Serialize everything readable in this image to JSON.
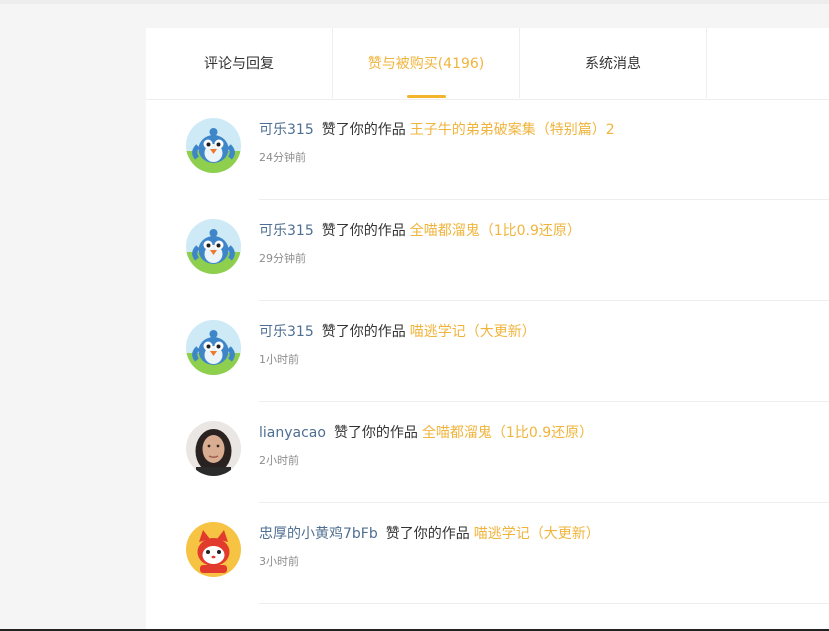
{
  "tabs": [
    {
      "label": "评论与回复",
      "active": false
    },
    {
      "label": "赞与被购买(4196)",
      "active": true
    },
    {
      "label": "系统消息",
      "active": false
    },
    {
      "label": "",
      "active": false
    }
  ],
  "notifications": [
    {
      "user": "可乐315",
      "action": "赞了你的作品",
      "work": "王子牛的弟弟破案集（特别篇）2",
      "time": "24分钟前",
      "avatar": "bird-avatar"
    },
    {
      "user": "可乐315",
      "action": "赞了你的作品",
      "work": "全喵都溜鬼（1比0.9还原）",
      "time": "29分钟前",
      "avatar": "bird-avatar"
    },
    {
      "user": "可乐315",
      "action": "赞了你的作品",
      "work": "喵逃学记（大更新）",
      "time": "1小时前",
      "avatar": "bird-avatar"
    },
    {
      "user": "lianyacao",
      "action": "赞了你的作品",
      "work": "全喵都溜鬼（1比0.9还原）",
      "time": "2小时前",
      "avatar": "photo-avatar"
    },
    {
      "user": "忠厚的小黄鸡7bFb",
      "action": "赞了你的作品",
      "work": "喵逃学记（大更新）",
      "time": "3小时前",
      "avatar": "cat-avatar"
    }
  ],
  "colors": {
    "accent": "#f0b43c",
    "username": "#4f6f92",
    "text": "#333333",
    "muted": "#8d8d8d",
    "divider": "#eeeeee"
  }
}
